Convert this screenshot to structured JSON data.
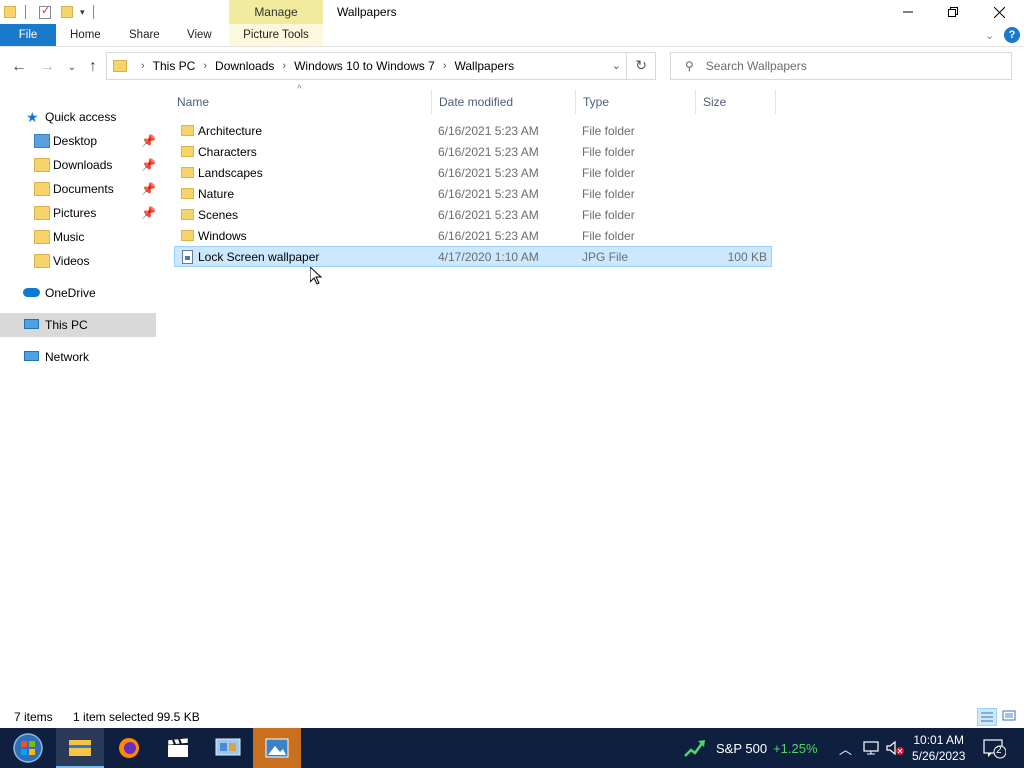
{
  "window": {
    "title": "Wallpapers",
    "context_tab": "Manage",
    "context_subtab": "Picture Tools"
  },
  "ribbon": {
    "tabs": [
      "File",
      "Home",
      "Share",
      "View"
    ]
  },
  "address": {
    "crumbs": [
      "This PC",
      "Downloads",
      "Windows 10 to Windows 7",
      "Wallpapers"
    ]
  },
  "search": {
    "placeholder": "Search Wallpapers"
  },
  "nav": {
    "quick_access": "Quick access",
    "pinned": [
      "Desktop",
      "Downloads",
      "Documents",
      "Pictures"
    ],
    "libraries": [
      "Music",
      "Videos"
    ],
    "onedrive": "OneDrive",
    "this_pc": "This PC",
    "network": "Network"
  },
  "columns": [
    "Name",
    "Date modified",
    "Type",
    "Size"
  ],
  "files": [
    {
      "name": "Architecture",
      "date": "6/16/2021 5:23 AM",
      "type": "File folder",
      "size": ""
    },
    {
      "name": "Characters",
      "date": "6/16/2021 5:23 AM",
      "type": "File folder",
      "size": ""
    },
    {
      "name": "Landscapes",
      "date": "6/16/2021 5:23 AM",
      "type": "File folder",
      "size": ""
    },
    {
      "name": "Nature",
      "date": "6/16/2021 5:23 AM",
      "type": "File folder",
      "size": ""
    },
    {
      "name": "Scenes",
      "date": "6/16/2021 5:23 AM",
      "type": "File folder",
      "size": ""
    },
    {
      "name": "Windows",
      "date": "6/16/2021 5:23 AM",
      "type": "File folder",
      "size": ""
    },
    {
      "name": "Lock Screen wallpaper",
      "date": "4/17/2020 1:10 AM",
      "type": "JPG File",
      "size": "100 KB"
    }
  ],
  "status": {
    "items": "7 items",
    "selected": "1 item selected",
    "selected_size": "99.5 KB"
  },
  "taskbar": {
    "stock_name": "S&P 500",
    "stock_change": "+1.25%",
    "time": "10:01 AM",
    "date": "5/26/2023",
    "notifications": "2"
  },
  "colors": {
    "file_tab": "#1979ca",
    "manage_tab": "#f2eb9d",
    "selection": "#cce8ff",
    "taskbar": "#0f1f3f",
    "stock_up": "#4cd964"
  }
}
